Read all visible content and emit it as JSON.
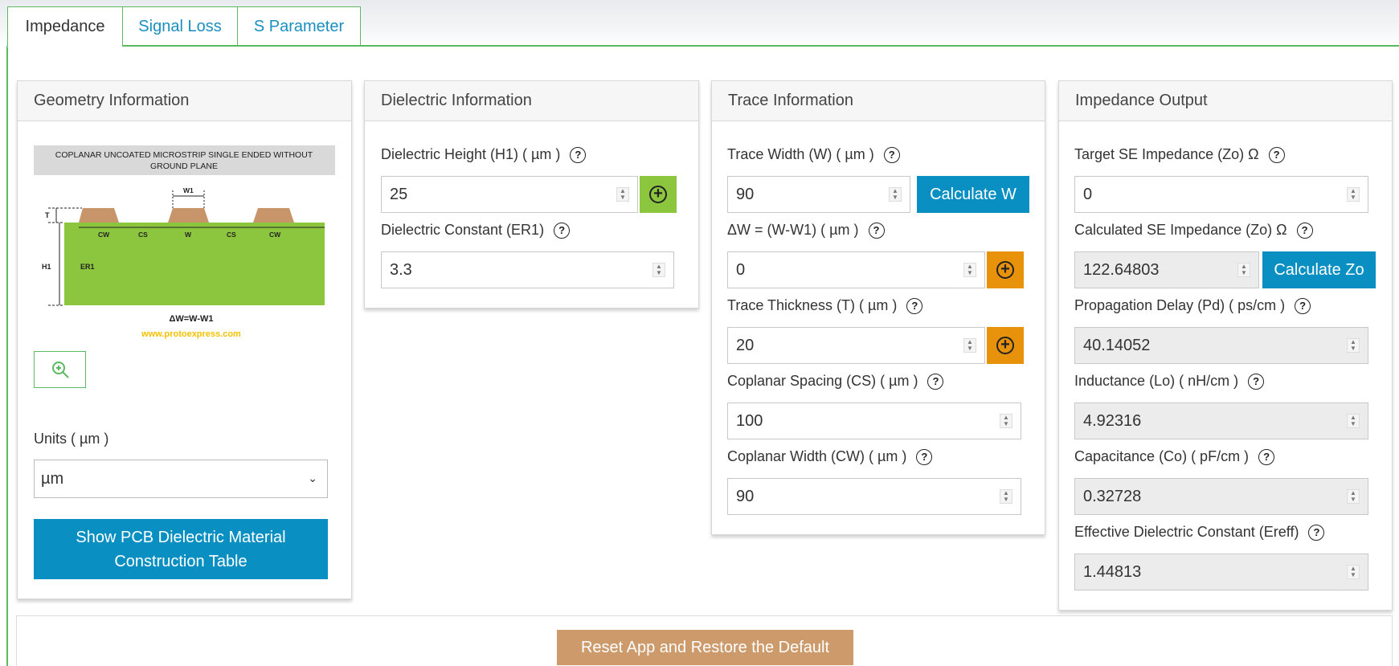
{
  "tabs": [
    {
      "label": "Impedance",
      "active": true
    },
    {
      "label": "Signal Loss",
      "active": false
    },
    {
      "label": "S Parameter",
      "active": false
    }
  ],
  "geometry": {
    "title": "Geometry Information",
    "diagram_caption": "COPLANAR UNCOATED MICROSTRIP SINGLE ENDED WITHOUT GROUND PLANE",
    "diagram_labels": {
      "t": "T",
      "h1": "H1",
      "er1": "ER1",
      "w1": "W1",
      "cw": "CW",
      "cs": "CS",
      "w": "W"
    },
    "formula": "ΔW=W-W1",
    "website": "www.protoexpress.com",
    "units_label": "Units ( µm )",
    "units_value": "µm",
    "material_button": "Show PCB Dielectric Material Construction Table"
  },
  "dielectric": {
    "title": "Dielectric Information",
    "height_label": "Dielectric Height (H1) ( µm )",
    "height_value": "25",
    "constant_label": "Dielectric Constant (ER1)",
    "constant_value": "3.3"
  },
  "trace": {
    "title": "Trace Information",
    "width_label": "Trace Width (W) ( µm )",
    "width_value": "90",
    "calc_w_button": "Calculate W",
    "delta_label": "ΔW = (W-W1) ( µm )",
    "delta_value": "0",
    "thickness_label": "Trace Thickness (T) ( µm )",
    "thickness_value": "20",
    "spacing_label": "Coplanar Spacing (CS) ( µm )",
    "spacing_value": "100",
    "cw_label": "Coplanar Width (CW) ( µm )",
    "cw_value": "90"
  },
  "output": {
    "title": "Impedance Output",
    "target_label": "Target SE Impedance (Zo) Ω",
    "target_value": "0",
    "calc_label": "Calculated SE Impedance (Zo) Ω",
    "calc_value": "122.64803",
    "calc_zo_button": "Calculate Zo",
    "delay_label": "Propagation Delay (Pd) ( ps/cm )",
    "delay_value": "40.14052",
    "ind_label": "Inductance (Lo) ( nH/cm )",
    "ind_value": "4.92316",
    "cap_label": "Capacitance (Co) ( pF/cm )",
    "cap_value": "0.32728",
    "ereff_label": "Effective Dielectric Constant (Ereff)",
    "ereff_value": "1.44813"
  },
  "reset_button": "Reset App and Restore the Default",
  "help_glyph": "?",
  "add_glyph": "+",
  "colors": {
    "accent_green": "#5bb95f",
    "blue_button": "#0a8fc2",
    "lime_add": "#8cc63f",
    "orange_add": "#e8920c",
    "reset": "#cc9a6b"
  }
}
